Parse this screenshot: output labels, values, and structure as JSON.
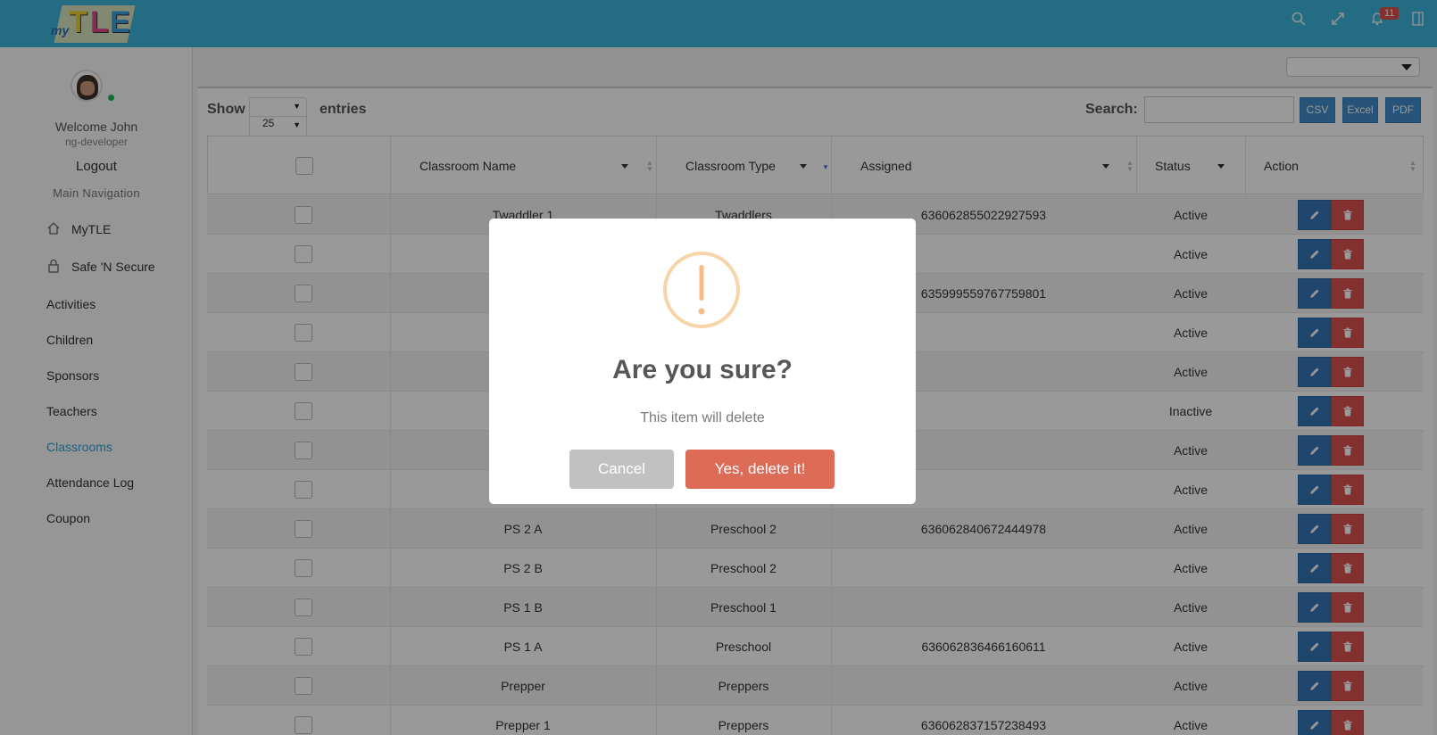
{
  "app": {
    "logo_prefix": "my",
    "logo_letters": [
      "T",
      "L",
      "E"
    ],
    "notification_count": "11"
  },
  "sidebar": {
    "welcome": "Welcome John",
    "role": "ng-developer",
    "logout": "Logout",
    "section_title": "Main Navigation",
    "items": [
      {
        "label": "MyTLE",
        "icon": "home-icon"
      },
      {
        "label": "Safe 'N Secure",
        "icon": "lock-icon"
      },
      {
        "label": "Activities"
      },
      {
        "label": "Children"
      },
      {
        "label": "Sponsors"
      },
      {
        "label": "Teachers"
      },
      {
        "label": "Classrooms",
        "active": true
      },
      {
        "label": "Attendance Log"
      },
      {
        "label": "Coupon"
      }
    ],
    "active_color": "#2aa3d6"
  },
  "toolbar": {
    "show_label": "Show",
    "entries_label": "entries",
    "page_length": "25",
    "search_label": "Search:",
    "search_value": "",
    "csv": "CSV",
    "excel": "Excel",
    "pdf": "PDF"
  },
  "table": {
    "columns": [
      "Classroom Name",
      "Classroom Type",
      "Assigned",
      "Status",
      "Action"
    ],
    "rows": [
      {
        "name": "Twaddler 1",
        "type": "Twaddlers",
        "assigned": "636062855022927593",
        "status": "Active"
      },
      {
        "name": "",
        "type": "",
        "assigned": "",
        "status": "Active"
      },
      {
        "name": "",
        "type": "",
        "assigned": "635999559767759801",
        "status": "Active"
      },
      {
        "name": "",
        "type": "",
        "assigned": "",
        "status": "Active"
      },
      {
        "name": "",
        "type": "",
        "assigned": "",
        "status": "Active"
      },
      {
        "name": "",
        "type": "",
        "assigned": "",
        "status": "Inactive"
      },
      {
        "name": "",
        "type": "",
        "assigned": "",
        "status": "Active"
      },
      {
        "name": "",
        "type": "",
        "assigned": "",
        "status": "Active"
      },
      {
        "name": "PS 2 A",
        "type": "Preschool 2",
        "assigned": "636062840672444978",
        "status": "Active"
      },
      {
        "name": "PS 2 B",
        "type": "Preschool 2",
        "assigned": "",
        "status": "Active"
      },
      {
        "name": "PS 1 B",
        "type": "Preschool 1",
        "assigned": "",
        "status": "Active"
      },
      {
        "name": "PS 1 A",
        "type": "Preschool",
        "assigned": "636062836466160611",
        "status": "Active"
      },
      {
        "name": "Prepper",
        "type": "Preppers",
        "assigned": "",
        "status": "Active"
      },
      {
        "name": "Prepper 1",
        "type": "Preppers",
        "assigned": "636062837157238493",
        "status": "Active"
      }
    ]
  },
  "modal": {
    "title": "Are you sure?",
    "text": "This item will delete",
    "cancel": "Cancel",
    "confirm": "Yes, delete it!",
    "icon": "warning-icon",
    "icon_color": "#f8bb86",
    "confirm_color": "#dd6b55"
  }
}
